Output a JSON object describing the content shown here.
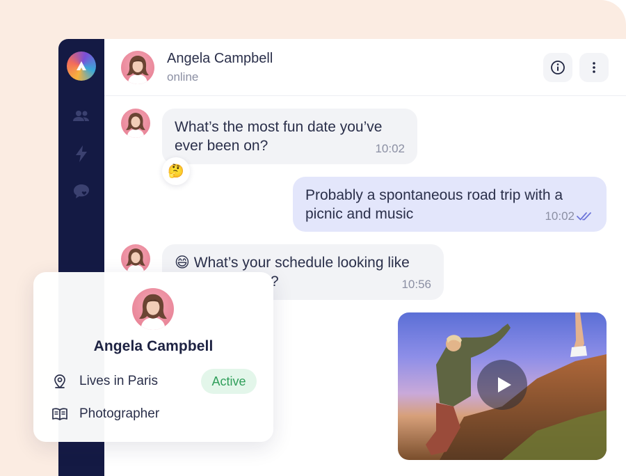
{
  "header": {
    "contact_name": "Angela Campbell",
    "status": "online"
  },
  "messages": [
    {
      "direction": "incoming",
      "text_line1": "What’s the most fun date you’ve",
      "text_line2": "ever been on?",
      "time": "10:02",
      "reaction": "🤔"
    },
    {
      "direction": "outgoing",
      "text_line1": "Probably a spontaneous road trip with a",
      "text_line2": "picnic and music",
      "time": "10:02",
      "read_receipt": "double-check-icon"
    },
    {
      "direction": "incoming",
      "emoji": "😄",
      "text_line1": "What’s your schedule looking like",
      "text_line2": "?",
      "time": "10:56"
    },
    {
      "direction": "incoming",
      "type": "video",
      "media_icon": "play-icon"
    }
  ],
  "profile_card": {
    "name": "Angela Campbell",
    "location": "Lives in Paris",
    "status_badge": "Active",
    "occupation": "Photographer"
  },
  "icons": {
    "sidebar": [
      "users-icon",
      "lightning-icon",
      "chat-heart-icon"
    ],
    "header": [
      "info-icon",
      "more-vertical-icon"
    ],
    "card": [
      "location-pin-icon",
      "book-icon"
    ]
  },
  "colors": {
    "sidebar_bg": "#141a44",
    "incoming_bubble": "#f2f3f6",
    "outgoing_bubble": "#e3e6fb",
    "read_receipt": "#6c74d9",
    "active_badge_bg": "#e3f6ea",
    "active_badge_text": "#2f9e5a",
    "backdrop": "#fbece2"
  }
}
